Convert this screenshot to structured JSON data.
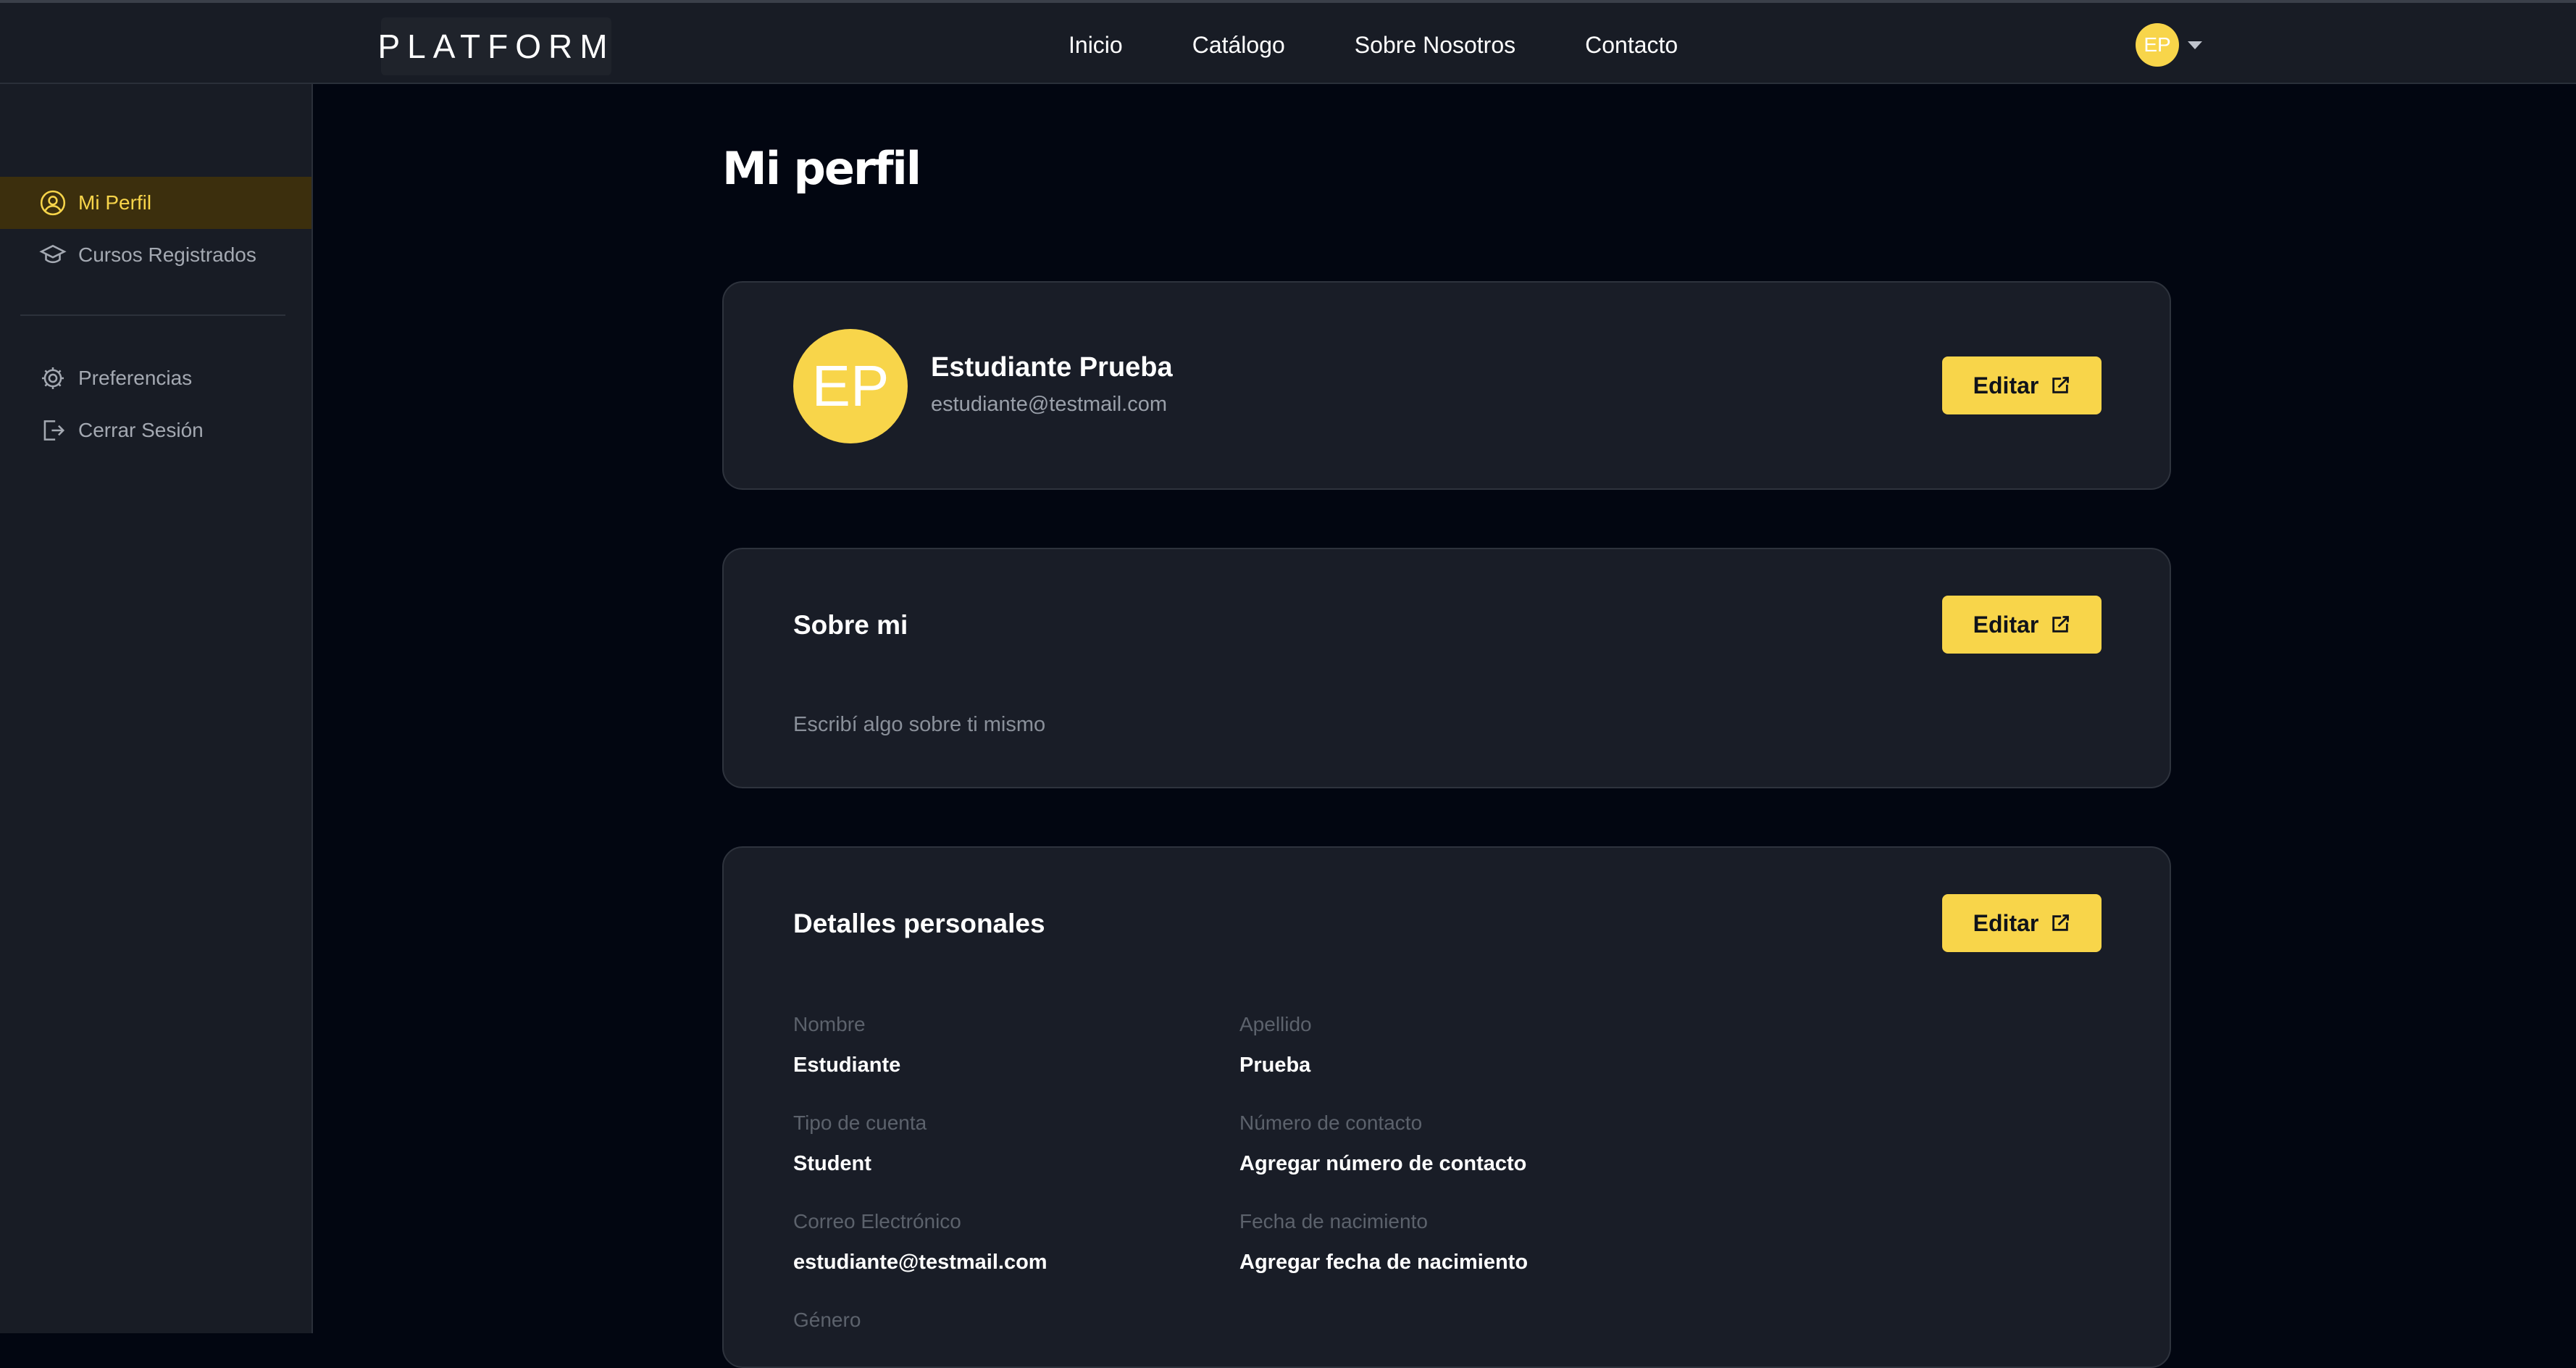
{
  "header": {
    "logo": "PLATFORM",
    "nav": [
      "Inicio",
      "Catálogo",
      "Sobre Nosotros",
      "Contacto"
    ],
    "user_initials": "EP"
  },
  "sidebar": {
    "items": [
      {
        "label": "Mi Perfil",
        "icon": "user-circle-icon",
        "active": true
      },
      {
        "label": "Cursos Registrados",
        "icon": "graduation-cap-icon",
        "active": false
      },
      {
        "label": "Preferencias",
        "icon": "gear-icon",
        "active": false
      },
      {
        "label": "Cerrar Sesión",
        "icon": "logout-icon",
        "active": false
      }
    ]
  },
  "main": {
    "title": "Mi perfil",
    "edit_label": "Editar",
    "profile": {
      "initials": "EP",
      "name": "Estudiante Prueba",
      "email": "estudiante@testmail.com"
    },
    "about": {
      "heading": "Sobre mi",
      "placeholder": "Escribí algo sobre ti mismo"
    },
    "details": {
      "heading": "Detalles personales",
      "fields": [
        {
          "label": "Nombre",
          "value": "Estudiante"
        },
        {
          "label": "Apellido",
          "value": "Prueba"
        },
        {
          "label": "Tipo de cuenta",
          "value": "Student"
        },
        {
          "label": "Número de contacto",
          "value": "Agregar número de contacto"
        },
        {
          "label": "Correo Electrónico",
          "value": "estudiante@testmail.com"
        },
        {
          "label": "Fecha de nacimiento",
          "value": "Agregar fecha de nacimiento"
        },
        {
          "label": "Género",
          "value": ""
        }
      ]
    }
  },
  "colors": {
    "accent": "#f8d54a",
    "background": "#020611",
    "panel": "#181c25",
    "card": "#191d27"
  }
}
